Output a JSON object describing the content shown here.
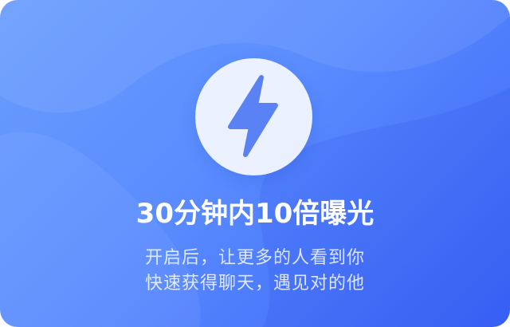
{
  "promo": {
    "icon": "lightning-bolt-icon",
    "title": "30分钟内10倍曝光",
    "subtitle_line1": "开启后，让更多的人看到你",
    "subtitle_line2": "快速获得聊天，遇见对的他"
  },
  "colors": {
    "gradient_start": "#6a9dfd",
    "gradient_end": "#3a64f6",
    "bolt": "#5b82f5",
    "circle": "#f6f9ff",
    "text": "#ffffff"
  }
}
